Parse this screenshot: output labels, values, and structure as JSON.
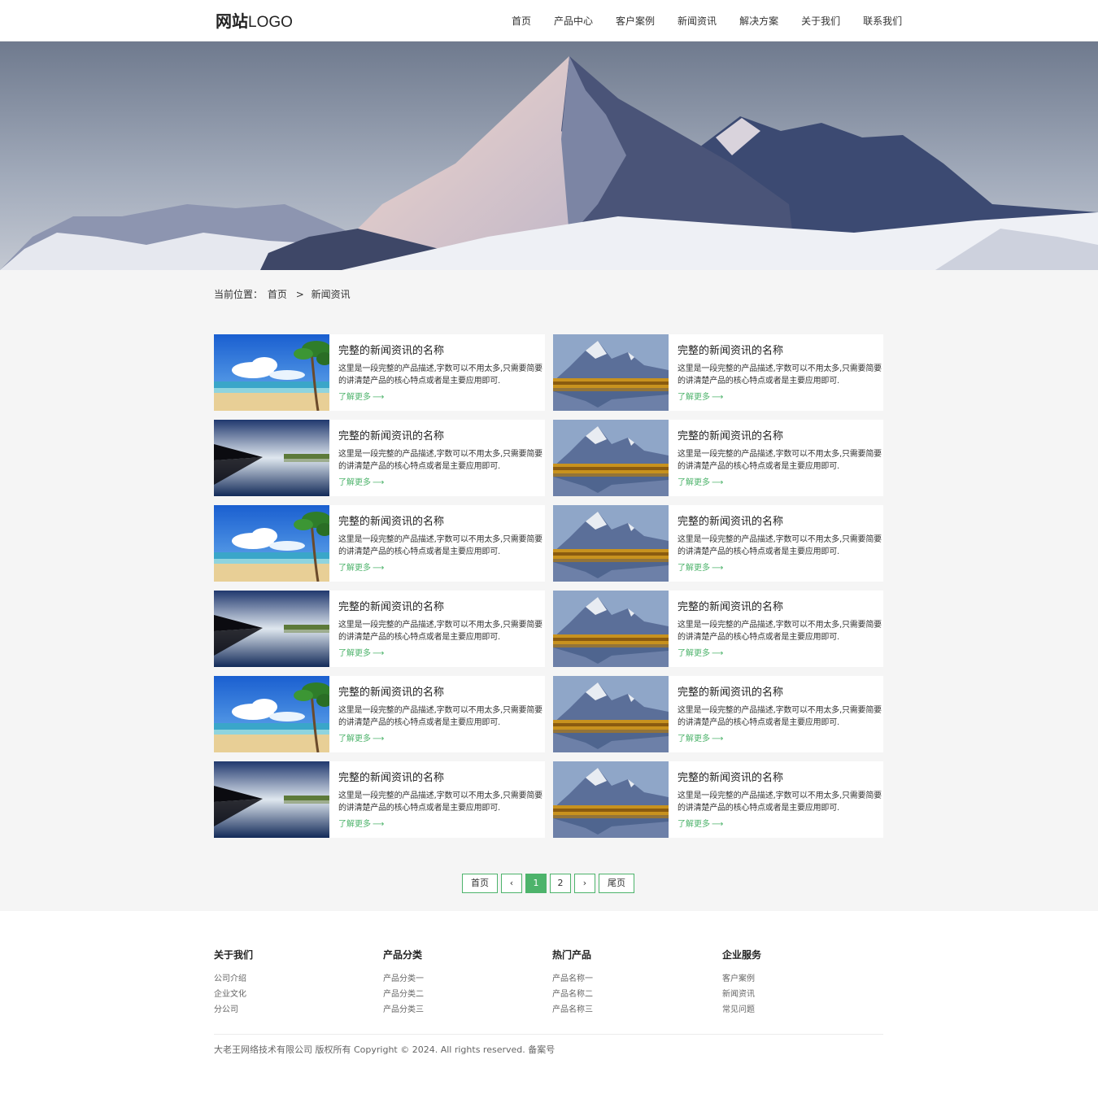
{
  "header": {
    "logo_bold": "网站",
    "logo_text": "LOGO",
    "nav": [
      "首页",
      "产品中心",
      "客户案例",
      "新闻资讯",
      "解决方案",
      "关于我们",
      "联系我们"
    ]
  },
  "breadcrumb": {
    "label": "当前位置：",
    "home": "首页",
    "separator": ">",
    "current": "新闻资讯"
  },
  "news": {
    "items": [
      {
        "image": "beach",
        "title": "完整的新闻资讯的名称",
        "desc": "这里是一段完整的产品描述,字数可以不用太多,只需要简要的讲清楚产品的核心特点或者是主要应用即可.",
        "more": "了解更多"
      },
      {
        "image": "mountain-lake",
        "title": "完整的新闻资讯的名称",
        "desc": "这里是一段完整的产品描述,字数可以不用太多,只需要简要的讲清楚产品的核心特点或者是主要应用即可.",
        "more": "了解更多"
      },
      {
        "image": "reflection-lake",
        "title": "完整的新闻资讯的名称",
        "desc": "这里是一段完整的产品描述,字数可以不用太多,只需要简要的讲清楚产品的核心特点或者是主要应用即可.",
        "more": "了解更多"
      },
      {
        "image": "mountain-lake",
        "title": "完整的新闻资讯的名称",
        "desc": "这里是一段完整的产品描述,字数可以不用太多,只需要简要的讲清楚产品的核心特点或者是主要应用即可.",
        "more": "了解更多"
      },
      {
        "image": "beach",
        "title": "完整的新闻资讯的名称",
        "desc": "这里是一段完整的产品描述,字数可以不用太多,只需要简要的讲清楚产品的核心特点或者是主要应用即可.",
        "more": "了解更多"
      },
      {
        "image": "mountain-lake",
        "title": "完整的新闻资讯的名称",
        "desc": "这里是一段完整的产品描述,字数可以不用太多,只需要简要的讲清楚产品的核心特点或者是主要应用即可.",
        "more": "了解更多"
      },
      {
        "image": "reflection-lake",
        "title": "完整的新闻资讯的名称",
        "desc": "这里是一段完整的产品描述,字数可以不用太多,只需要简要的讲清楚产品的核心特点或者是主要应用即可.",
        "more": "了解更多"
      },
      {
        "image": "mountain-lake",
        "title": "完整的新闻资讯的名称",
        "desc": "这里是一段完整的产品描述,字数可以不用太多,只需要简要的讲清楚产品的核心特点或者是主要应用即可.",
        "more": "了解更多"
      },
      {
        "image": "beach",
        "title": "完整的新闻资讯的名称",
        "desc": "这里是一段完整的产品描述,字数可以不用太多,只需要简要的讲清楚产品的核心特点或者是主要应用即可.",
        "more": "了解更多"
      },
      {
        "image": "mountain-lake",
        "title": "完整的新闻资讯的名称",
        "desc": "这里是一段完整的产品描述,字数可以不用太多,只需要简要的讲清楚产品的核心特点或者是主要应用即可.",
        "more": "了解更多"
      },
      {
        "image": "reflection-lake",
        "title": "完整的新闻资讯的名称",
        "desc": "这里是一段完整的产品描述,字数可以不用太多,只需要简要的讲清楚产品的核心特点或者是主要应用即可.",
        "more": "了解更多"
      },
      {
        "image": "mountain-lake",
        "title": "完整的新闻资讯的名称",
        "desc": "这里是一段完整的产品描述,字数可以不用太多,只需要简要的讲清楚产品的核心特点或者是主要应用即可.",
        "more": "了解更多"
      }
    ]
  },
  "pagination": {
    "first": "首页",
    "prev": "‹",
    "pages": [
      "1",
      "2"
    ],
    "current": "1",
    "next": "›",
    "last": "尾页"
  },
  "footer": {
    "columns": [
      {
        "title": "关于我们",
        "links": [
          "公司介绍",
          "企业文化",
          "分公司"
        ]
      },
      {
        "title": "产品分类",
        "links": [
          "产品分类一",
          "产品分类二",
          "产品分类三"
        ]
      },
      {
        "title": "热门产品",
        "links": [
          "产品名称一",
          "产品名称二",
          "产品名称三"
        ]
      },
      {
        "title": "企业服务",
        "links": [
          "客户案例",
          "新闻资讯",
          "常见问题"
        ]
      }
    ],
    "copyright": "大老王网络技术有限公司 版权所有 Copyright © 2024. All rights reserved. 备案号"
  },
  "colors": {
    "accent": "#4db36b",
    "page_bg": "#f5f5f5"
  }
}
